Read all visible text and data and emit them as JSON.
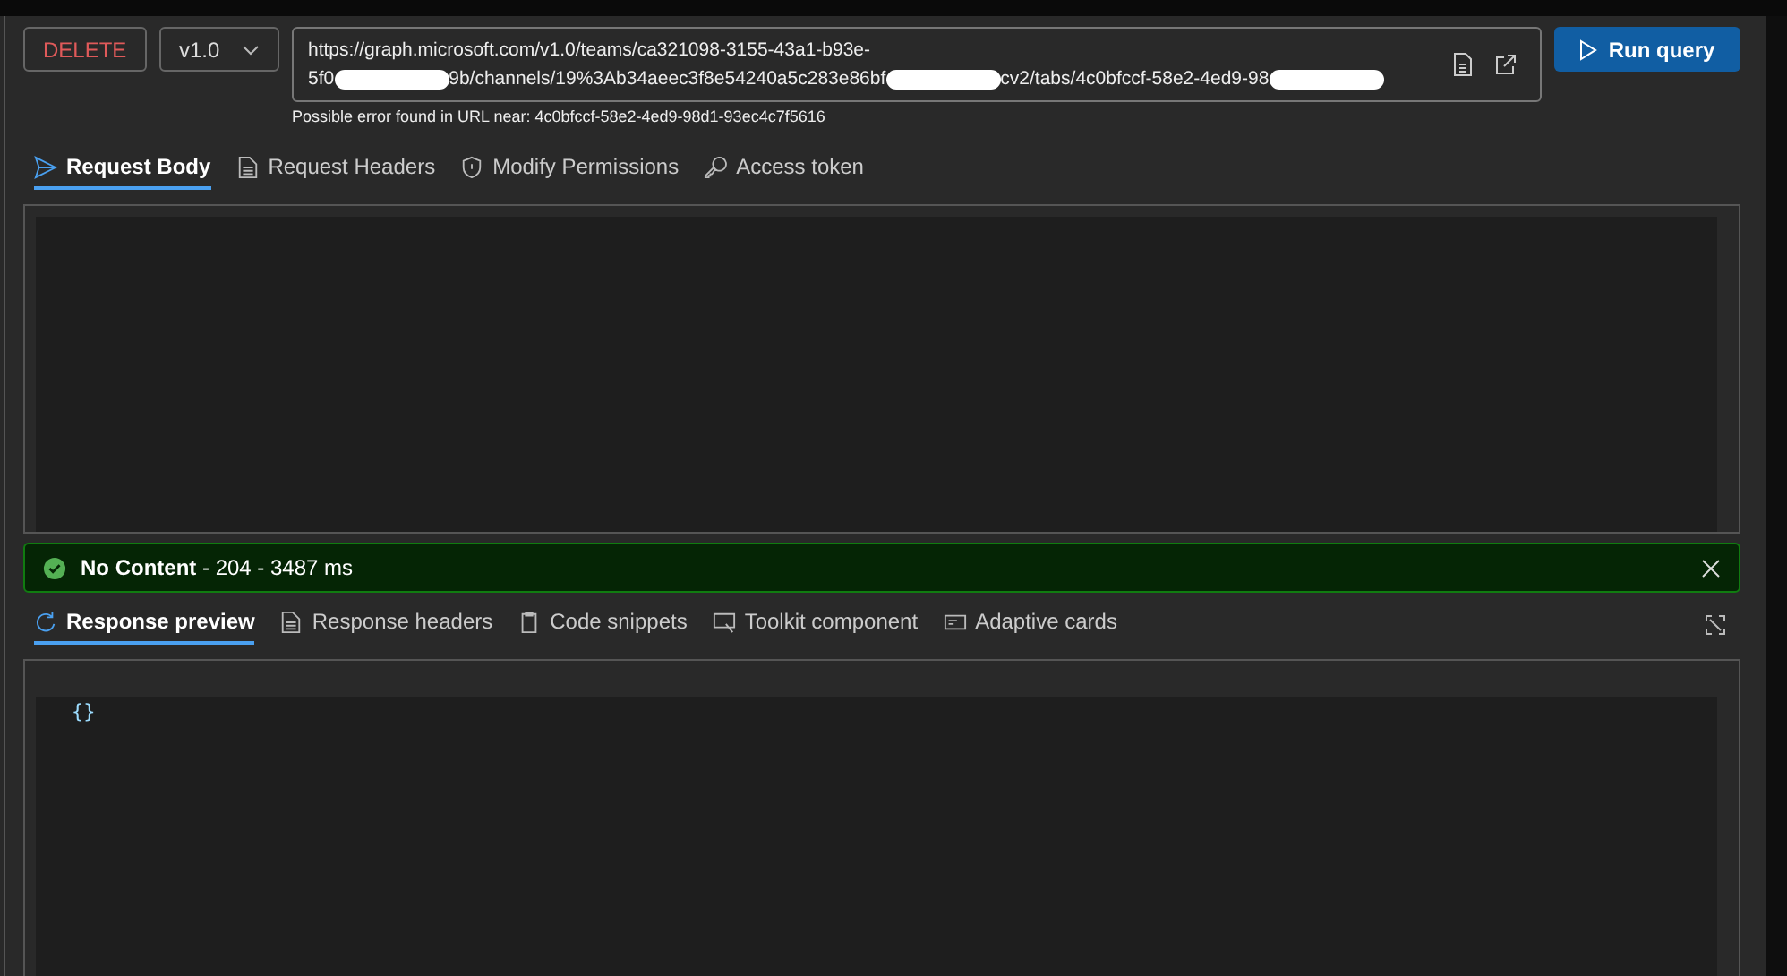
{
  "method": {
    "label": "DELETE"
  },
  "version": {
    "label": "v1.0"
  },
  "url": {
    "segments": [
      {
        "kind": "text",
        "text": "https://graph.microsoft.com/v1.0/teams/ca321098-3155-43a1-b93e-"
      },
      {
        "kind": "break"
      },
      {
        "kind": "text",
        "text": "5f0"
      },
      {
        "kind": "redacted"
      },
      {
        "kind": "text",
        "text": "9b/channels/19%3Ab34aeec3f8e54240a5c283e86bf"
      },
      {
        "kind": "redacted"
      },
      {
        "kind": "text",
        "text": "cv2/tabs/4c0bfccf-58e2-4ed9-98"
      },
      {
        "kind": "redacted"
      }
    ],
    "error": "Possible error found in URL near: 4c0bfccf-58e2-4ed9-98d1-93ec4c7f5616"
  },
  "run_button": "Run query",
  "request_tabs": [
    {
      "label": "Request Body",
      "kind": "send",
      "selected": true
    },
    {
      "label": "Request Headers",
      "kind": "doc",
      "selected": false
    },
    {
      "label": "Modify Permissions",
      "kind": "shield",
      "selected": false
    },
    {
      "label": "Access token",
      "kind": "key",
      "selected": false
    }
  ],
  "status": {
    "title": "No Content",
    "detail": " - 204 - 3487 ms",
    "kind": "success"
  },
  "response_tabs": [
    {
      "label": "Response preview",
      "kind": "preview",
      "selected": true
    },
    {
      "label": "Response headers",
      "kind": "doc",
      "selected": false
    },
    {
      "label": "Code snippets",
      "kind": "clip",
      "selected": false
    },
    {
      "label": "Toolkit component",
      "kind": "tool",
      "selected": false
    },
    {
      "label": "Adaptive cards",
      "kind": "card",
      "selected": false
    }
  ],
  "response_body": "{}"
}
